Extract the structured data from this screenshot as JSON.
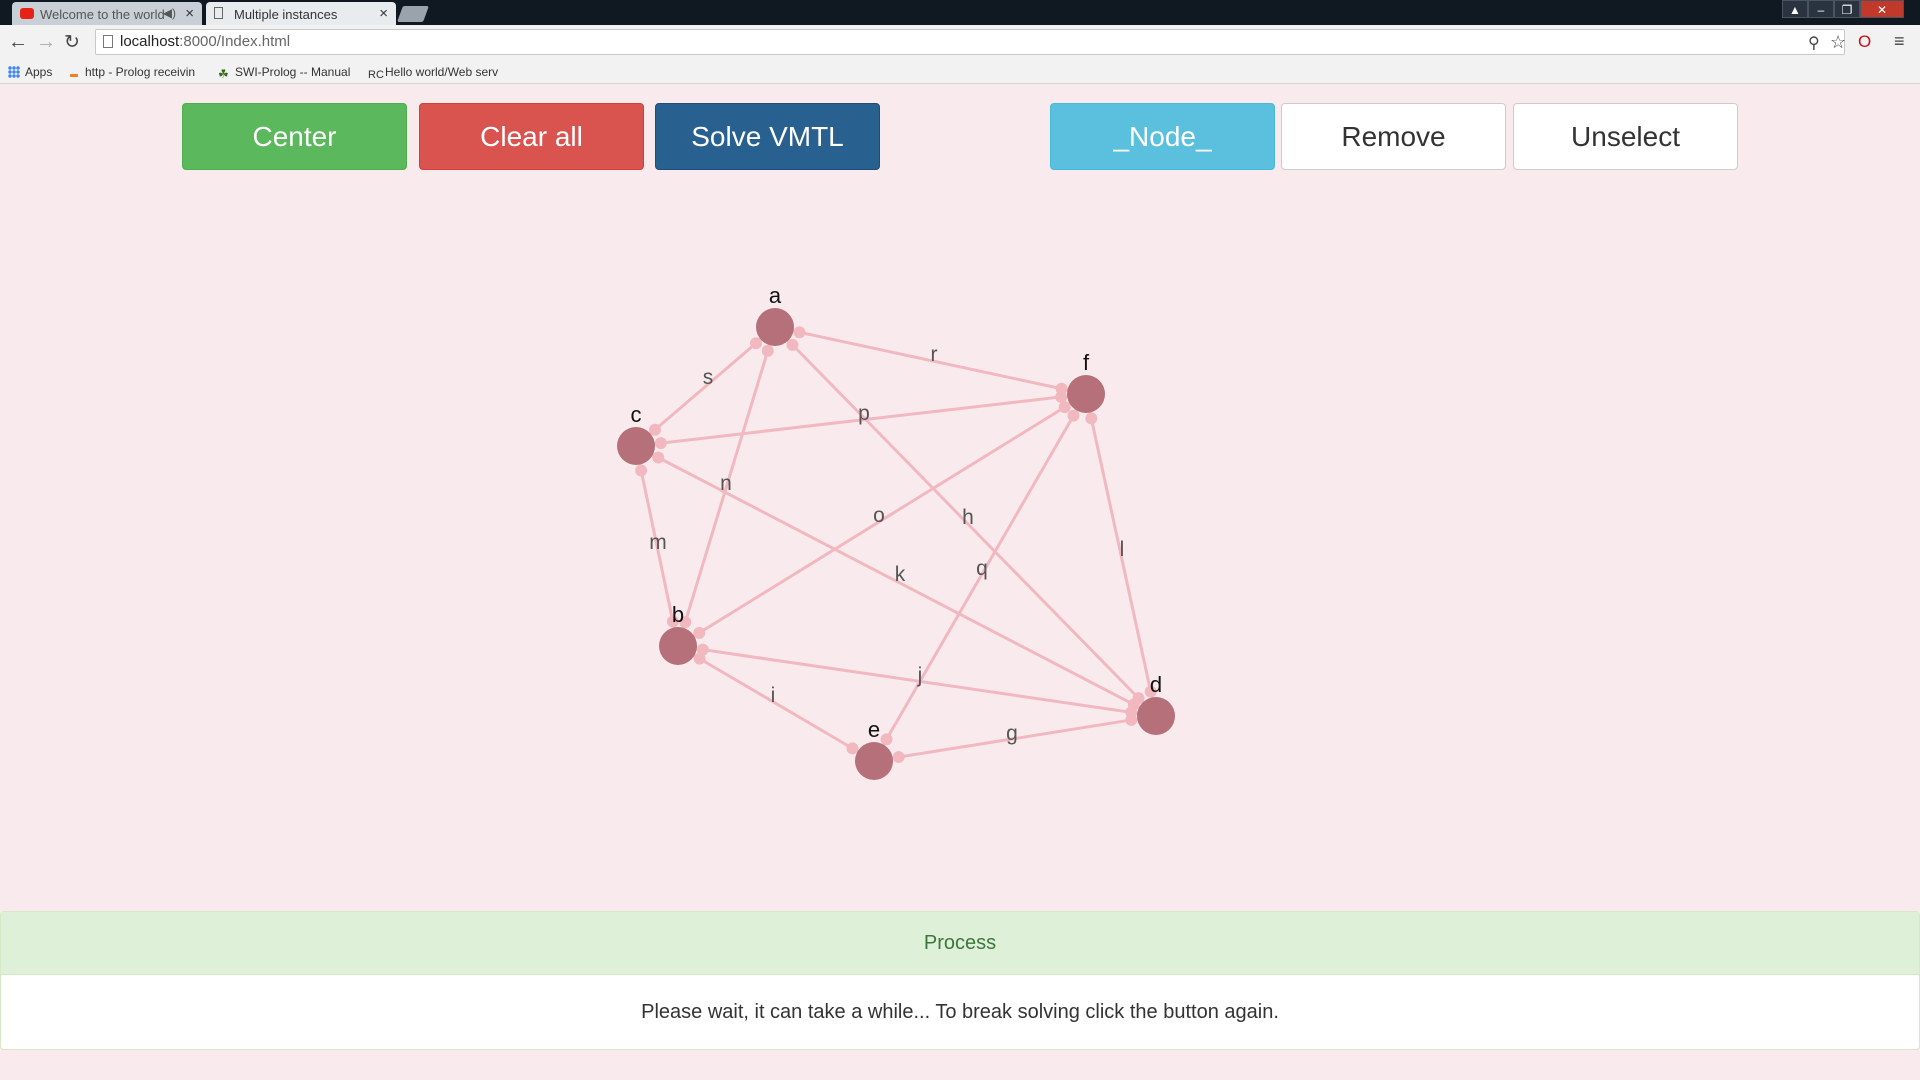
{
  "browser": {
    "tabs": [
      {
        "title": "Welcome to the world",
        "icon": "youtube-icon",
        "active": false
      },
      {
        "title": "Multiple instances",
        "icon": "page-icon",
        "active": true
      }
    ],
    "address": {
      "host": "localhost",
      "path": ":8000/Index.html"
    },
    "bookmarks": [
      {
        "label": "Apps",
        "icon": "apps-icon"
      },
      {
        "label": "http - Prolog receivin",
        "icon": "stackoverflow-icon"
      },
      {
        "label": "SWI-Prolog -- Manual",
        "icon": "swi-prolog-icon"
      },
      {
        "label": "Hello world/Web serv",
        "icon": "rosetta-icon"
      }
    ]
  },
  "toolbar": {
    "center_label": "Center",
    "clear_label": "Clear all",
    "solve_label": "Solve VMTL",
    "node_label": "_Node_",
    "remove_label": "Remove",
    "unselect_label": "Unselect"
  },
  "graph": {
    "node_color": "#b5707a",
    "edge_color": "#f2b8c0",
    "nodes": [
      {
        "id": "a"
      },
      {
        "id": "b"
      },
      {
        "id": "c"
      },
      {
        "id": "d"
      },
      {
        "id": "e"
      },
      {
        "id": "f"
      }
    ],
    "edges": [
      {
        "label": "r",
        "from": "a",
        "to": "f"
      },
      {
        "label": "s",
        "from": "a",
        "to": "c"
      },
      {
        "label": "n",
        "from": "a",
        "to": "b"
      },
      {
        "label": "h",
        "from": "a",
        "to": "d"
      },
      {
        "label": "p",
        "from": "c",
        "to": "f"
      },
      {
        "label": "m",
        "from": "c",
        "to": "b"
      },
      {
        "label": "k",
        "from": "c",
        "to": "d"
      },
      {
        "label": "o",
        "from": "b",
        "to": "f"
      },
      {
        "label": "j",
        "from": "b",
        "to": "d"
      },
      {
        "label": "i",
        "from": "b",
        "to": "e"
      },
      {
        "label": "q",
        "from": "e",
        "to": "f"
      },
      {
        "label": "g",
        "from": "e",
        "to": "d"
      },
      {
        "label": "l",
        "from": "f",
        "to": "d"
      }
    ]
  },
  "panel": {
    "heading": "Process",
    "body": "Please wait, it can take a while... To break solving click the button again."
  }
}
